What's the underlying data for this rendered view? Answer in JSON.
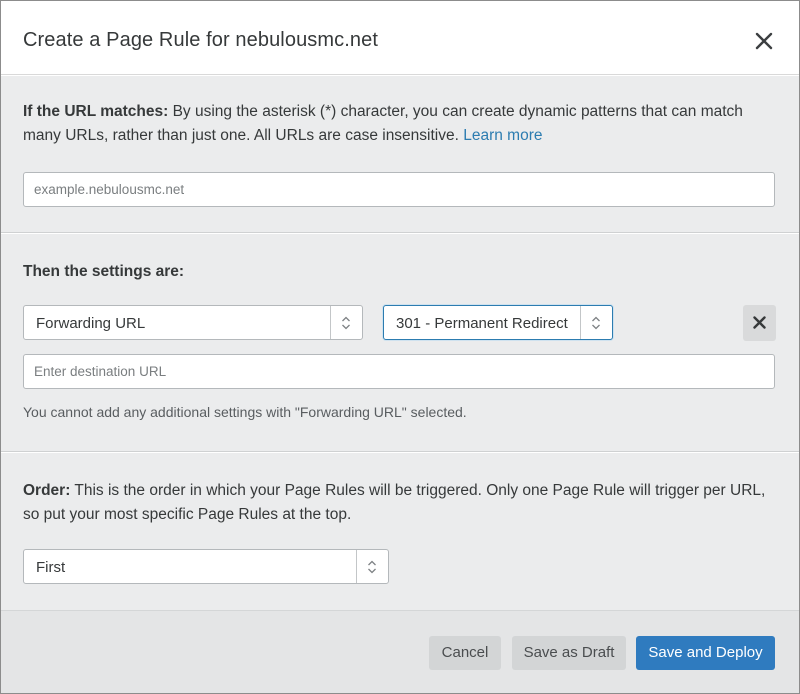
{
  "dialog": {
    "title": "Create a Page Rule for nebulousmc.net",
    "close_icon": "close-icon"
  },
  "url_section": {
    "label_bold": "If the URL matches:",
    "description": " By using the asterisk (*) character, you can create dynamic patterns that can match many URLs, rather than just one. All URLs are case insensitive. ",
    "learn_more": "Learn more",
    "input_placeholder": "example.nebulousmc.net"
  },
  "settings_section": {
    "heading": "Then the settings are:",
    "setting_select": {
      "selected": "Forwarding URL"
    },
    "status_select": {
      "selected": "301 - Permanent Redirect"
    },
    "remove_icon": "close-icon",
    "destination_placeholder": "Enter destination URL",
    "note": "You cannot add any additional settings with \"Forwarding URL\" selected."
  },
  "order_section": {
    "label_bold": "Order:",
    "description": " This is the order in which your Page Rules will be triggered. Only one Page Rule will trigger per URL, so put your most specific Page Rules at the top.",
    "order_select": {
      "selected": "First"
    }
  },
  "footer": {
    "cancel_label": "Cancel",
    "draft_label": "Save as Draft",
    "deploy_label": "Save and Deploy"
  },
  "colors": {
    "primary": "#2f7bbf",
    "link": "#2c7cb0",
    "section_bg": "#ebeced",
    "footer_bg": "#e4e5e6"
  }
}
